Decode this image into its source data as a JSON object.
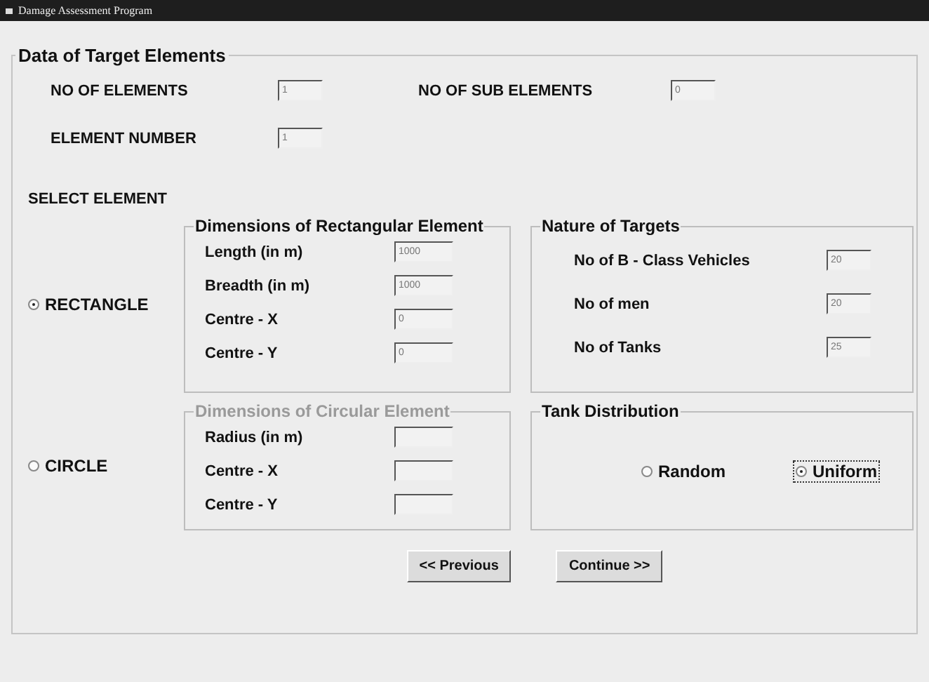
{
  "window": {
    "title": "Damage Assessment Program"
  },
  "target_elements": {
    "legend": "Data of Target Elements",
    "fields": [
      {
        "label": "NO OF ELEMENTS",
        "value": "1"
      },
      {
        "label": "NO OF SUB ELEMENTS",
        "value": "0"
      },
      {
        "label": "ELEMENT NUMBER",
        "value": "1"
      }
    ],
    "select_label": "SELECT ELEMENT",
    "element_options": [
      {
        "label": "RECTANGLE",
        "selected": true,
        "group": {
          "legend": "Dimensions  of Rectangular Element",
          "disabled": false,
          "fields": [
            {
              "label": "Length (in m)",
              "value": "1000"
            },
            {
              "label": "Breadth (in m)",
              "value": "1000"
            },
            {
              "label": "Centre - X",
              "value": "0"
            },
            {
              "label": "Centre - Y",
              "value": "0"
            }
          ]
        }
      },
      {
        "label": "CIRCLE",
        "selected": false,
        "group": {
          "legend": "Dimensions  of Circular Element",
          "disabled": true,
          "fields": [
            {
              "label": "Radius (in m)"
            },
            {
              "label": "Centre - X"
            },
            {
              "label": "Centre - Y"
            }
          ]
        }
      }
    ],
    "nature_of_targets": {
      "legend": "Nature of Targets",
      "fields": [
        {
          "label": "No of B - Class Vehicles",
          "value": "20"
        },
        {
          "label": "No of men",
          "value": "20"
        },
        {
          "label": "No of Tanks",
          "value": "25"
        }
      ]
    },
    "tank_distribution": {
      "legend": "Tank Distribution",
      "options": [
        {
          "label": "Random",
          "selected": false,
          "focused": false
        },
        {
          "label": "Uniform",
          "selected": true,
          "focused": true
        }
      ]
    },
    "buttons": [
      "<< Previous",
      "Continue >>"
    ]
  }
}
